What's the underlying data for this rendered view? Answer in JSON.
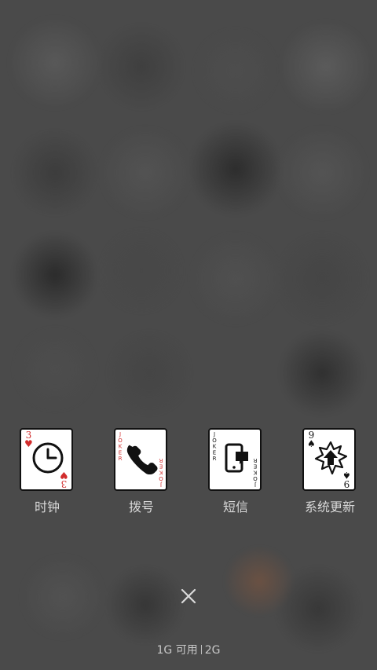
{
  "recent_apps": [
    {
      "name": "时钟",
      "icon": "clock-icon",
      "card_style": "playing-card",
      "card_rank": "3",
      "card_suit": "♥",
      "card_color": "#d12c2c"
    },
    {
      "name": "拨号",
      "icon": "phone-icon",
      "card_style": "joker-card",
      "card_mark_top": "JOKER",
      "card_mark_bottom": "JOKER",
      "card_color": "#d12c2c"
    },
    {
      "name": "短信",
      "icon": "sms-icon",
      "card_style": "joker-card",
      "card_mark_top": "JOKER",
      "card_mark_bottom": "JOKER",
      "card_color": "#111111"
    },
    {
      "name": "系统更新",
      "icon": "system-update-icon",
      "card_style": "playing-card",
      "card_rank": "9",
      "card_suit": "♠",
      "card_color": "#111111"
    }
  ],
  "controls": {
    "close_icon": "close-icon"
  },
  "memory": {
    "available": "1G 可用",
    "total": "2G"
  },
  "colors": {
    "overlay": "#4a4a4a",
    "label": "#d8d8d8",
    "memory_text": "#c8c8c8"
  }
}
